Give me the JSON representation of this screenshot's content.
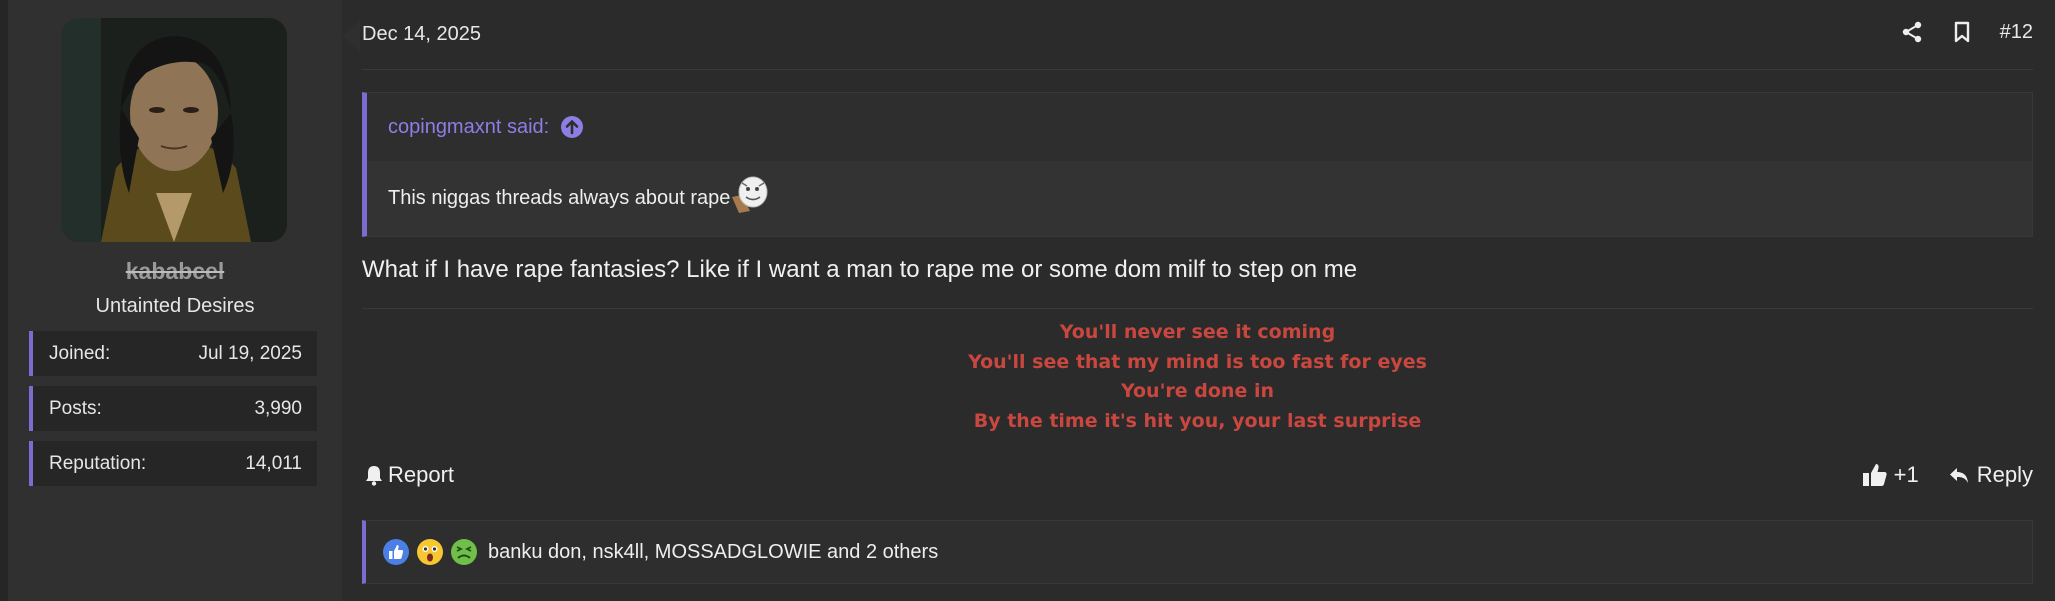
{
  "user": {
    "name": "kababcel",
    "title": "Untainted Desires",
    "stats": [
      {
        "label": "Joined:",
        "value": "Jul 19, 2025"
      },
      {
        "label": "Posts:",
        "value": "3,990"
      },
      {
        "label": "Reputation:",
        "value": "14,011"
      }
    ]
  },
  "post": {
    "date": "Dec 14, 2025",
    "number": "#12",
    "quote": {
      "author": "copingmaxnt said:",
      "text": "This niggas threads always about rape"
    },
    "message": "What if I have rape fantasies? Like if I want a man to rape me or some dom milf to step on me",
    "signature": [
      "You'll never see it coming",
      "You'll see that my mind is too fast for eyes",
      "You're done in",
      "By the time it's hit you, your last surprise"
    ],
    "actions": {
      "report": "Report",
      "like_count": "+1",
      "reply": "Reply"
    },
    "reactions": {
      "names": "banku don, nsk4ll, MOSSADGLOWIE and 2 others",
      "icons": [
        "like-reaction-icon",
        "shocked-reaction-icon",
        "sick-reaction-icon"
      ]
    }
  },
  "colors": {
    "accent": "#7c6cd1",
    "signature": "#c9473f",
    "background": "#2b2b2b"
  }
}
